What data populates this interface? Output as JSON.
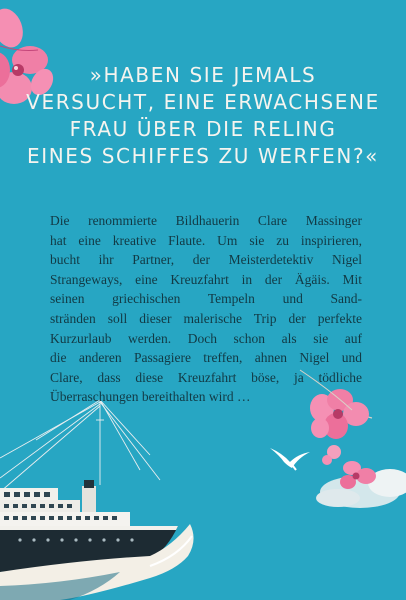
{
  "quote": {
    "lines": [
      "»HABEN SIE JEMALS",
      "VERSUCHT, EINE ERWACHSENE",
      "FRAU ÜBER DIE RELING",
      "EINES SCHIFFES ZU WERFEN?«"
    ]
  },
  "blurb": {
    "lines": [
      "Die renommierte Bildhauerin Clare Massinger",
      "hat eine kreative Flaute. Um sie zu inspirieren,",
      "bucht ihr Partner, der Meisterdetektiv Nigel",
      "Strangeways, eine Kreuzfahrt in der Ägäis. Mit",
      "seinen griechischen Tempeln und Sand-",
      "stränden soll dieser malerische Trip der perfekte",
      "Kurzurlaub werden. Doch schon als sie auf",
      "die anderen Passagiere treffen, ahnen Nigel und",
      "Clare, dass diese Kreuzfahrt böse, ja tödliche",
      "Überraschungen bereithalten wird …"
    ]
  },
  "colors": {
    "background": "#27a6c3",
    "quote_text": "#f5f4ef",
    "blurb_text": "#123a45",
    "blossom": "#f07fa6",
    "ship_hull": "#1d2b33",
    "wave": "#f3efe6"
  },
  "icons": [
    "cherry-blossom-icon",
    "seagull-icon",
    "ship-illustration"
  ]
}
